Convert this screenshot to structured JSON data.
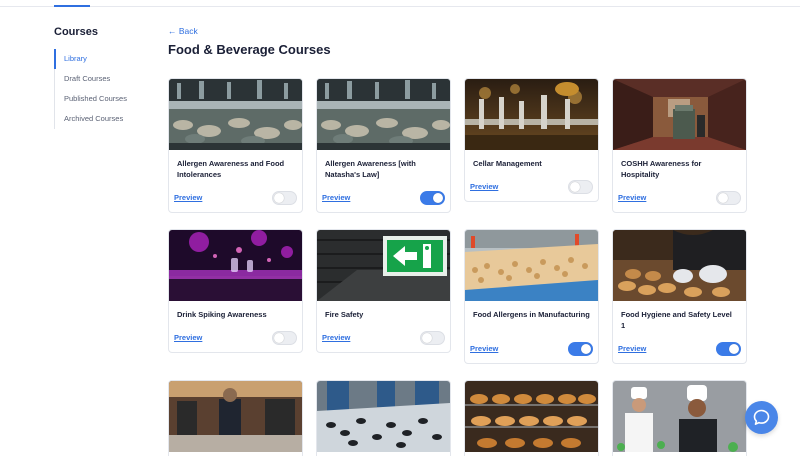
{
  "sidebar": {
    "title": "Courses",
    "items": [
      {
        "label": "Library",
        "active": true
      },
      {
        "label": "Draft Courses",
        "active": false
      },
      {
        "label": "Published Courses",
        "active": false
      },
      {
        "label": "Archived Courses",
        "active": false
      }
    ]
  },
  "header": {
    "back_label": "← Back",
    "title": "Food & Beverage Courses"
  },
  "courses": [
    {
      "title": "Allergen Awareness and Food Intolerances",
      "preview_label": "Preview",
      "enabled": false,
      "image": "seafood-counter-photo"
    },
    {
      "title": "Allergen Awareness [with Natasha's Law]",
      "preview_label": "Preview",
      "enabled": true,
      "image": "seafood-counter-photo"
    },
    {
      "title": "Cellar Management",
      "preview_label": "Preview",
      "enabled": false,
      "image": "beer-taps-photo"
    },
    {
      "title": "COSHH Awareness for Hospitality",
      "preview_label": "Preview",
      "enabled": false,
      "image": "hotel-corridor-cart-photo"
    },
    {
      "title": "Drink Spiking Awareness",
      "preview_label": "Preview",
      "enabled": false,
      "image": "nightclub-bar-photo"
    },
    {
      "title": "Fire Safety",
      "preview_label": "Preview",
      "enabled": false,
      "image": "exit-sign-photo"
    },
    {
      "title": "Food Allergens in Manufacturing",
      "preview_label": "Preview",
      "enabled": true,
      "image": "conveyor-nuts-photo"
    },
    {
      "title": "Food Hygiene and Safety Level 1",
      "preview_label": "Preview",
      "enabled": true,
      "image": "baker-gloves-photo"
    },
    {
      "title": "",
      "preview_label": "",
      "enabled": false,
      "image": "kitchen-chef-photo"
    },
    {
      "title": "",
      "preview_label": "",
      "enabled": false,
      "image": "mussels-conveyor-photo"
    },
    {
      "title": "",
      "preview_label": "",
      "enabled": false,
      "image": "bread-rack-photo"
    },
    {
      "title": "",
      "preview_label": "",
      "enabled": false,
      "image": "chefs-portrait-photo"
    }
  ],
  "colors": {
    "accent": "#2f6fe0",
    "toggle_on": "#3b7be8",
    "help_button": "#4a86e8"
  },
  "help": {
    "icon": "chat-bubble-icon"
  }
}
